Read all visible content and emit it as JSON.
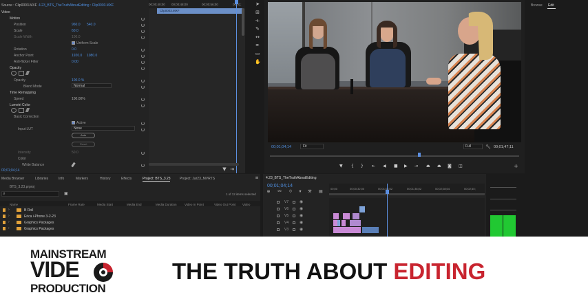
{
  "effect_controls": {
    "source_label": "Source : Clip0003.MXF",
    "sequence_label": "4.23_BTS_TheTruthAboutEditing : Clip0003.MXF",
    "section_video": "Video",
    "motion": "Motion",
    "position_label": "Position",
    "position_x": "960.0",
    "position_y": "540.0",
    "scale_label": "Scale",
    "scale_value": "60.0",
    "scale_width_label": "Scale Width",
    "scale_width_value": "100.0",
    "uniform_scale": "Uniform Scale",
    "rotation_label": "Rotation",
    "rotation_value": "0.0",
    "anchor_label": "Anchor Point",
    "anchor_x": "1920.0",
    "anchor_y": "1080.0",
    "antiflicker_label": "Anti-flicker Filter",
    "antiflicker_value": "0.00",
    "opacity": "Opacity",
    "opacity_label": "Opacity",
    "opacity_value": "100.0 %",
    "blend_label": "Blend Mode",
    "blend_value": "Normal",
    "time_remap": "Time Remapping",
    "speed_label": "Speed",
    "speed_value": "100.00%",
    "lumetri": "Lumetri Color",
    "basic_correction": "Basic Correction",
    "active_label": "Active",
    "input_lut_label": "Input LUT",
    "input_lut_value": "None",
    "auto_button": "Auto",
    "reset_button": "Reset",
    "intensity_label": "Intensity",
    "intensity_value": "50.0",
    "color_label": "Color",
    "white_balance_label": "White Balance",
    "timecode": "00;01;04;14",
    "clip_name": "Clip0003.MXF",
    "ruler": [
      "00;00;40;00",
      "00;00;48;00",
      "00;00;56;00",
      "00;01;"
    ]
  },
  "program_monitor": {
    "timecode": "00;01;04;14",
    "fit": "Fit",
    "quality": "Full",
    "duration": "00;01;47;11"
  },
  "right_tabs": {
    "browse": "Browse",
    "edit": "Edit"
  },
  "project_panel": {
    "tabs": [
      "Media Browser",
      "Libraries",
      "Info",
      "Markers",
      "History",
      "Effects",
      "Project: BTS_3.23",
      "Project: Jar23_MVRTS"
    ],
    "project_file": "BTS_3.23.prproj",
    "items_selected": "1 of 12 items selected",
    "columns": [
      "Name",
      "Frame Rate",
      "Media Start",
      "Media End",
      "Media Duration",
      "Video In Point",
      "Video Out Point",
      "Video"
    ],
    "bins": [
      "B Roll",
      "Erica i-Phone 3-2-23",
      "Graphics Packages",
      "Graphics Packages"
    ]
  },
  "timeline": {
    "sequence_tab": "4.23_BTS_TheTruthAboutEditing",
    "timecode": "00;01;04;14",
    "ruler": [
      "00;00",
      "00;00;32;00",
      "00;01;04;02",
      "00;01;36;02",
      "00;02;08;04",
      "00;02;40;"
    ],
    "tracks": [
      "V7",
      "V6",
      "V5",
      "V4",
      "V3"
    ]
  },
  "banner": {
    "logo_line1": "MAINSTREAM",
    "logo_line2": "VIDE",
    "logo_line3": "PRODUCTION",
    "title_part1": "THE TRUTH ABOUT",
    "title_part2": "EDITING",
    "accent_color": "#c8242f"
  },
  "colors": {
    "panel_bg": "#232323",
    "blue_value": "#4f8fe0",
    "meter_green": "#21c832",
    "bin_orange": "#e0a13a",
    "clip_pink": "#c98ad6",
    "clip_blue": "#7da2d8"
  }
}
